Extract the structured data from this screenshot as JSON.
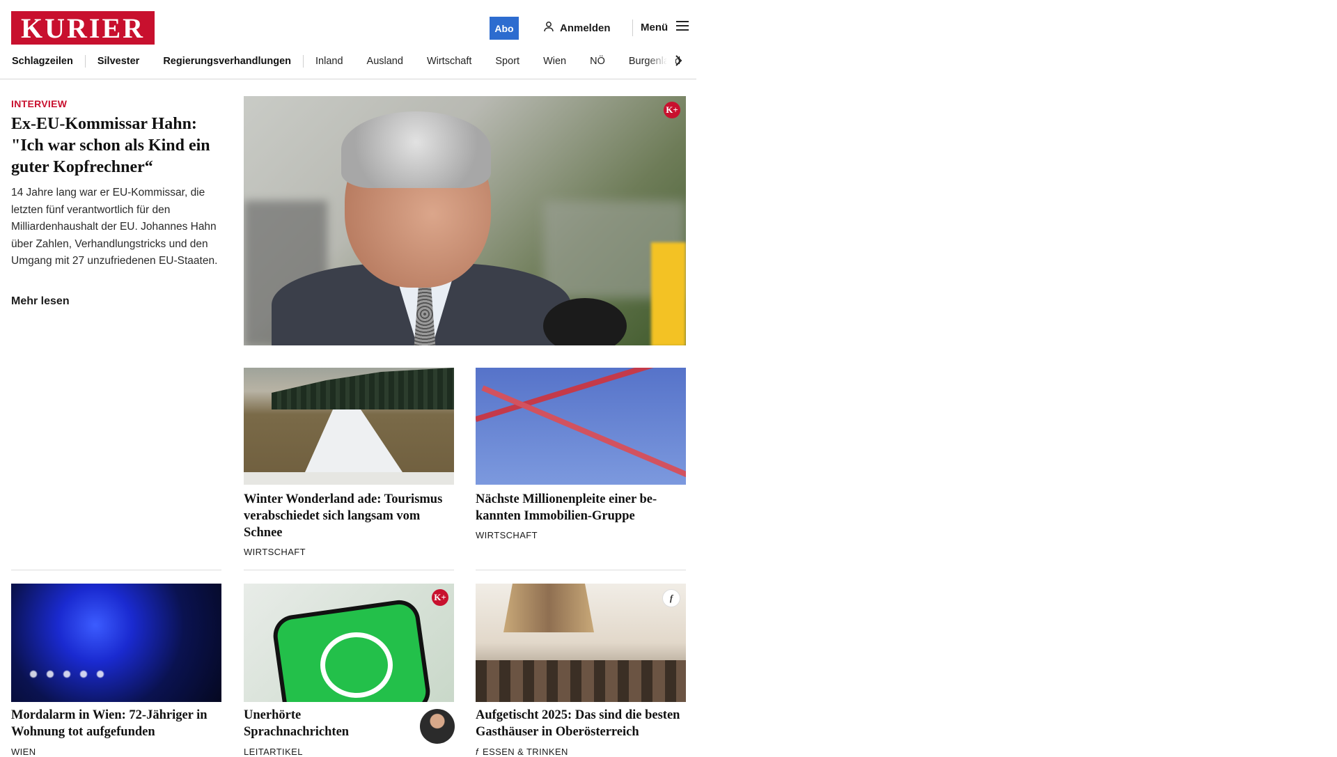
{
  "header": {
    "logo_text": "KURIER",
    "abo_label": "Abo",
    "login_label": "Anmelden",
    "menu_label": "Menü",
    "brand_color": "#c8102e",
    "abo_color": "#2d6ccf"
  },
  "nav": {
    "items": [
      "Schlagzeilen",
      "Silvester",
      "Regierungsverhandlungen",
      "Inland",
      "Ausland",
      "Wirtschaft",
      "Sport",
      "Wien",
      "NÖ",
      "Burgenland"
    ]
  },
  "lead": {
    "kicker": "INTERVIEW",
    "title": "Ex-EU-Kommissar Hahn: \"Ich war schon als Kind ein guter Kopfrechner“",
    "teaser": "14 Jahre lang war er EU-Kommissar, die letzten fünf verantwortlich für den Milliardenhaushalt der EU. Johannes Hahn über Zahlen, Verhandlungstricks und den Umgang mit 27 unzufriedenen EU-Staaten.",
    "more_label": "Mehr lesen",
    "badge": "K+"
  },
  "articles": [
    {
      "title": "Winter Wonderland ade: Touris­mus verabschiedet sich langsam vom Schnee",
      "category": "WIRTSCHAFT"
    },
    {
      "title": "Nächste Millionenpleite einer be­kannten Immobilien-Gruppe",
      "category": "WIRTSCHAFT"
    },
    {
      "title": "Mordalarm in Wien: 72-Jähriger in Wohnung tot aufgefunden",
      "category": "WIEN"
    },
    {
      "title": "Unerhörte Sprachnachrichten",
      "category": "LEITARTIKEL",
      "badge": "K+"
    },
    {
      "title": "Aufgetischt 2025: Das sind die bes­ten Gasthäuser in Oberösterreich",
      "category": "ESSEN & TRINKEN",
      "badge": "f"
    }
  ]
}
